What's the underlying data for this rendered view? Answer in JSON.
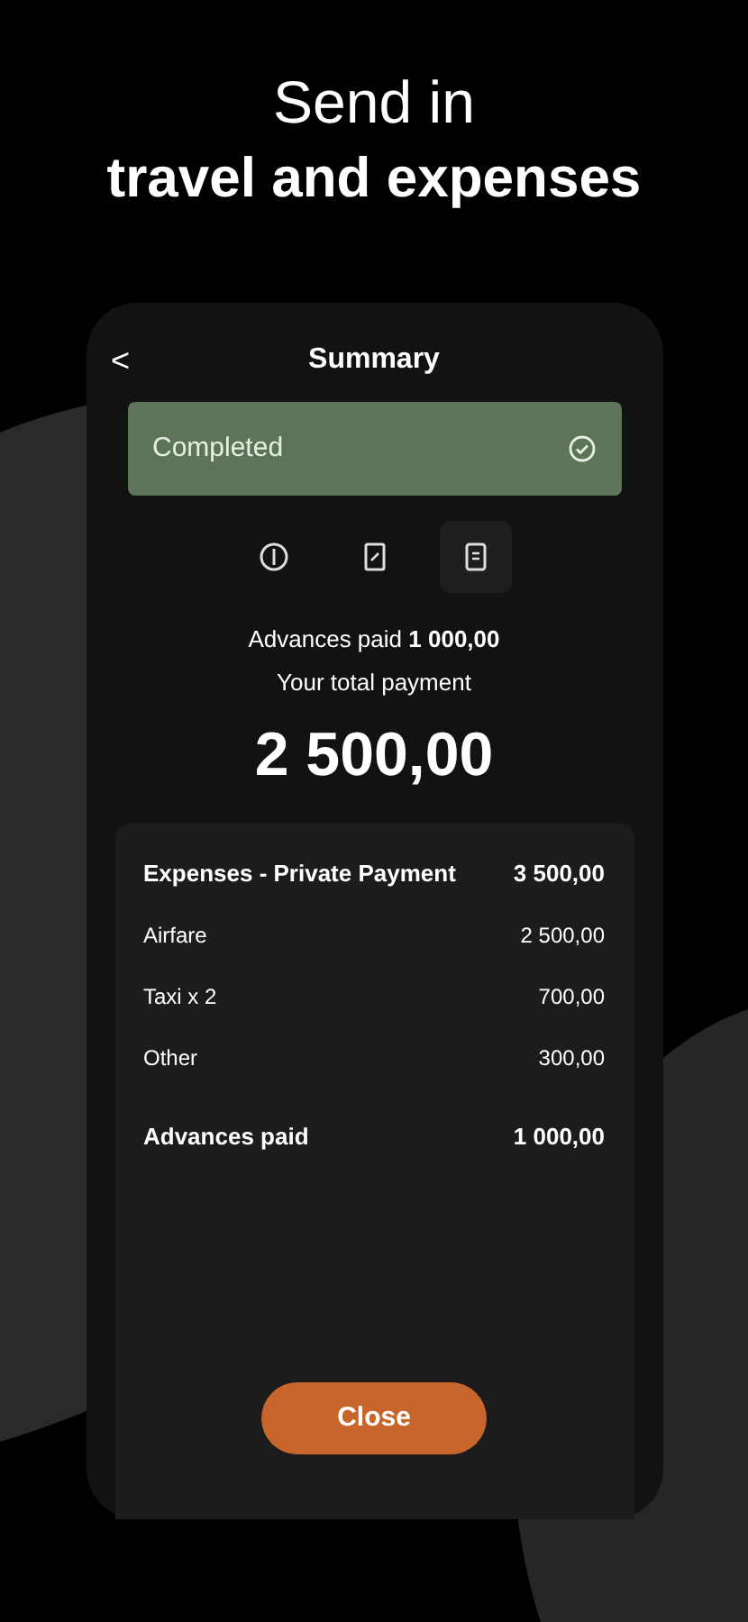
{
  "headline": {
    "line_1": "Send in",
    "line_2": "travel and expenses"
  },
  "screen": {
    "title": "Summary",
    "back": "<",
    "status": {
      "label": "Completed",
      "completed": true
    },
    "steps": [
      {
        "kind": "info",
        "selected": false
      },
      {
        "kind": "receipt",
        "selected": false
      },
      {
        "kind": "document",
        "selected": true
      }
    ],
    "advances_label": "Advances paid **1 000,00**",
    "total_label": "Your total payment",
    "total": "2 500,00",
    "rows": [
      {
        "kind": "header",
        "label": "Expenses - Private Payment",
        "amount": "3 500,00"
      },
      {
        "kind": "item",
        "label": "Airfare",
        "amount": "2 500,00"
      },
      {
        "kind": "item",
        "label": "Taxi x 2",
        "amount": "700,00"
      },
      {
        "kind": "item",
        "label": "Other",
        "amount": "300,00"
      },
      {
        "kind": "total",
        "label": "Advances paid",
        "amount": "1 000,00"
      }
    ],
    "close_button": "Close"
  }
}
